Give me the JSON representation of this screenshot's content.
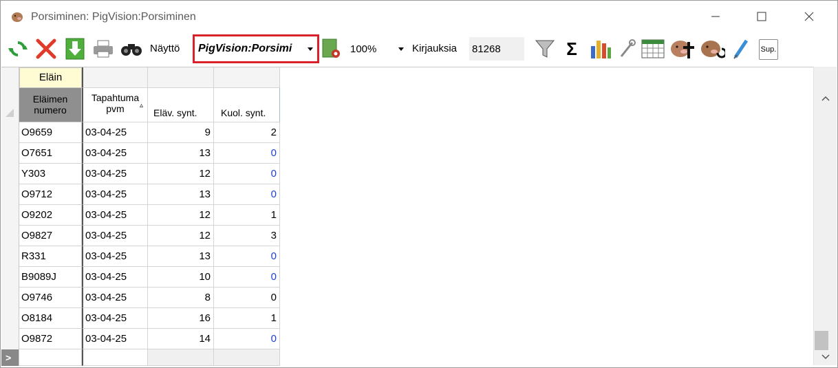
{
  "window": {
    "title": "Porsiminen: PigVision:Porsiminen"
  },
  "toolbar": {
    "view_label": "Näyttö",
    "view_selected": "PigVision:Porsimi ",
    "zoom_value": "100%",
    "records_label": "Kirjauksia",
    "records_count": "81268",
    "sup_label": "Sup."
  },
  "grid": {
    "group_header": "Eläin",
    "columns": [
      {
        "label": "Eläimen numero",
        "line1": "Eläimen",
        "line2": "numero"
      },
      {
        "label": "Tapahtuma pvm",
        "line1": "Tapahtuma",
        "line2": "pvm"
      },
      {
        "label": "Eläv. synt."
      },
      {
        "label": "Kuol. synt."
      }
    ],
    "rows": [
      {
        "animal": "O9659",
        "date": "03-04-25",
        "alive": "9",
        "dead": "2"
      },
      {
        "animal": "O7651",
        "date": "03-04-25",
        "alive": "13",
        "dead": "0"
      },
      {
        "animal": "Y303",
        "date": "03-04-25",
        "alive": "12",
        "dead": "0"
      },
      {
        "animal": "O9712",
        "date": "03-04-25",
        "alive": "13",
        "dead": "0"
      },
      {
        "animal": "O9202",
        "date": "03-04-25",
        "alive": "12",
        "dead": "1"
      },
      {
        "animal": "O9827",
        "date": "03-04-25",
        "alive": "12",
        "dead": "3"
      },
      {
        "animal": "R331",
        "date": "03-04-25",
        "alive": "13",
        "dead": "0"
      },
      {
        "animal": "B9089J",
        "date": "03-04-25",
        "alive": "10",
        "dead": "0"
      },
      {
        "animal": "O9746",
        "date": "03-04-25",
        "alive": "8",
        "dead": "0"
      },
      {
        "animal": "O8184",
        "date": "03-04-25",
        "alive": "16",
        "dead": "1"
      },
      {
        "animal": "O9872",
        "date": "03-04-25",
        "alive": "14",
        "dead": "0"
      }
    ],
    "new_row_marker": ">"
  },
  "colors": {
    "highlight_border": "#d9212b",
    "zero_value_blue": "#1f3fdc",
    "group_header_bg": "#fffbd2",
    "sorted_header_bg": "#8f8f8f"
  },
  "icons": [
    "app-pig-icon",
    "refresh-icon",
    "delete-icon",
    "download-icon",
    "print-icon",
    "binoculars-icon",
    "settings-gear-icon",
    "filter-funnel-icon",
    "sigma-icon",
    "bar-chart-icon",
    "wrench-icon",
    "calendar-icon",
    "pig-cross-icon",
    "pig-refresh-icon",
    "syringe-icon"
  ]
}
